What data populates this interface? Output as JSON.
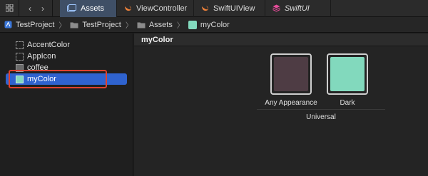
{
  "tabbar": {
    "tabs": [
      {
        "label": "Assets",
        "icon": "assets-icon",
        "active": true
      },
      {
        "label": "ViewController",
        "icon": "swift-icon",
        "active": false
      },
      {
        "label": "SwiftUIView",
        "icon": "swift-icon",
        "active": false
      },
      {
        "label": "SwiftUI",
        "icon": "swiftui-icon",
        "active": false
      }
    ]
  },
  "breadcrumb": {
    "items": [
      {
        "label": "TestProject",
        "icon": "xcode-project-icon"
      },
      {
        "label": "TestProject",
        "icon": "folder-icon"
      },
      {
        "label": "Assets",
        "icon": "assets-icon"
      },
      {
        "label": "myColor",
        "icon": "color-set-icon"
      }
    ]
  },
  "sidebar": {
    "items": [
      {
        "label": "AccentColor",
        "icon": "color-set-icon"
      },
      {
        "label": "AppIcon",
        "icon": "app-icon-set-icon"
      },
      {
        "label": "coffee",
        "icon": "image-set-icon"
      },
      {
        "label": "myColor",
        "icon": "color-set-icon",
        "selected": true
      }
    ]
  },
  "main": {
    "title": "myColor",
    "wells": [
      {
        "label": "Any Appearance",
        "color": "#4e3c44"
      },
      {
        "label": "Dark",
        "color": "#82d9bd"
      }
    ],
    "group_label": "Universal"
  },
  "colors": {
    "accent": "#2f63cf",
    "highlight_box": "#e0412e",
    "active_tab": "#3f4f66"
  }
}
